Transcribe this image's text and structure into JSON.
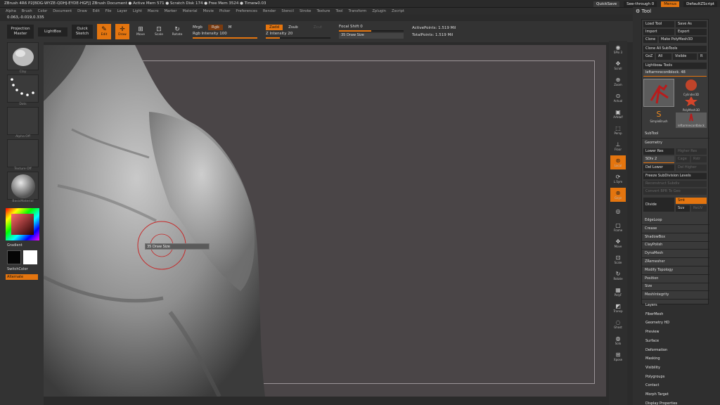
{
  "titlebar": {
    "text": "ZBrush 4R6 P2[BDG-WYZE-QDHJ-EYDE-HGFJ]    ZBrush Document    ● Active Mem 571 ● Scratch Disk 174 ● Free Mem 3524 ● Timer▸0.03",
    "quicksave": "QuickSave",
    "seethrough": "See-through  0",
    "menus": "Menus",
    "script": "DefaultZScript"
  },
  "menubar": [
    "Alpha",
    "Brush",
    "Color",
    "Document",
    "Draw",
    "Edit",
    "File",
    "Layer",
    "Light",
    "Macro",
    "Marker",
    "Material",
    "Movie",
    "Picker",
    "Preferences",
    "Render",
    "Stencil",
    "Stroke",
    "Texture",
    "Tool",
    "Transform",
    "Zplugin",
    "Zscript"
  ],
  "coords": "0.063,-0.019,0.335",
  "shelf": {
    "projection_master": "Projection Master",
    "lightbox": "LightBox",
    "quick_sketch": "Quick Sketch",
    "edit": "Edit",
    "draw": "Draw",
    "move": "Move",
    "scale": "Scale",
    "rotate": "Rotate",
    "mrgb": "Mrgb",
    "rgb": "Rgb",
    "m": "M",
    "rgb_intensity": "Rgb Intensity 100",
    "zadd": "Zadd",
    "zsub": "Zsub",
    "zcut": "Zcut",
    "z_intensity": "Z Intensity 20",
    "focal_shift": "Focal Shift 0",
    "draw_size": "Draw Size",
    "draw_size_value": "35",
    "active_points": "ActivePoints: 1.519 Mil",
    "total_points": "TotalPoints: 1.519 Mil"
  },
  "left": {
    "brush_label": "Clay",
    "stroke_label": "Dots",
    "alpha_label": "Alpha Off",
    "texture_label": "Texture Off",
    "material_label": "BasicMaterial",
    "gradient": "Gradient",
    "switch_color": "SwitchColor",
    "alternate": "Alternate"
  },
  "cursor": {
    "value": "35",
    "label": "Draw Size"
  },
  "rightshelf": [
    "SPix 3",
    "Scroll",
    "Zoom",
    "Actual",
    "AAHalf",
    "Persp",
    "Floor",
    "Local",
    "L.Sym",
    "Gxyz",
    "",
    "Frame",
    "Move",
    "Scale",
    "Rotate",
    "PolyF",
    "Transp",
    "Ghost",
    "Solo",
    "Xpose"
  ],
  "tool": {
    "title": "Tool",
    "load_tool": "Load Tool",
    "save_as": "Save As",
    "import": "Import",
    "export": "Export",
    "clone": "Clone",
    "make_polymesh": "Make PolyMesh3D",
    "clone_all": "Clone All SubTools",
    "goz": "GoZ",
    "all": "All",
    "visible": "Visible",
    "r": "R",
    "lightbox_tools": "Lightbox▸ Tools",
    "current_tool": "leftarmrecordblock. 48",
    "thumb_labels": [
      "leftarmrecordblock",
      "Cylinder3D",
      "PolyMesh3D",
      "SimpleBrush",
      "leftarmrecordblock"
    ],
    "subtool": "SubTool",
    "geometry": "Geometry",
    "lower_res": "Lower Res",
    "higher_res": "Higher Res",
    "sdiv": "SDiv 2",
    "cage": "Cage",
    "rstr": "Rstr",
    "del_lower": "Del Lower",
    "del_higher": "Del Higher",
    "freeze": "Freeze SubDivision Levels",
    "reconstruct": "Reconstruct Subdiv",
    "convert_bpr": "Convert BPR To Geo",
    "divide": "Divide",
    "smt": "Smt",
    "suv": "Suv",
    "reuv": "ReUV",
    "sections": [
      "EdgeLoop",
      "Crease",
      "ShadowBox",
      "ClayPolish",
      "DynaMesh",
      "ZRemesher",
      "Modify Topology",
      "Position",
      "Size",
      "MeshIntegrity"
    ],
    "menus": [
      "Layers",
      "FiberMesh",
      "Geometry HD",
      "Preview",
      "Surface",
      "Deformation",
      "Masking",
      "Visibility",
      "Polygroups",
      "Contact",
      "Morph Target",
      "Display Properties"
    ]
  },
  "colors": {
    "accent": "#e4750f",
    "canvas": "#4a4547",
    "panel": "#333333"
  }
}
